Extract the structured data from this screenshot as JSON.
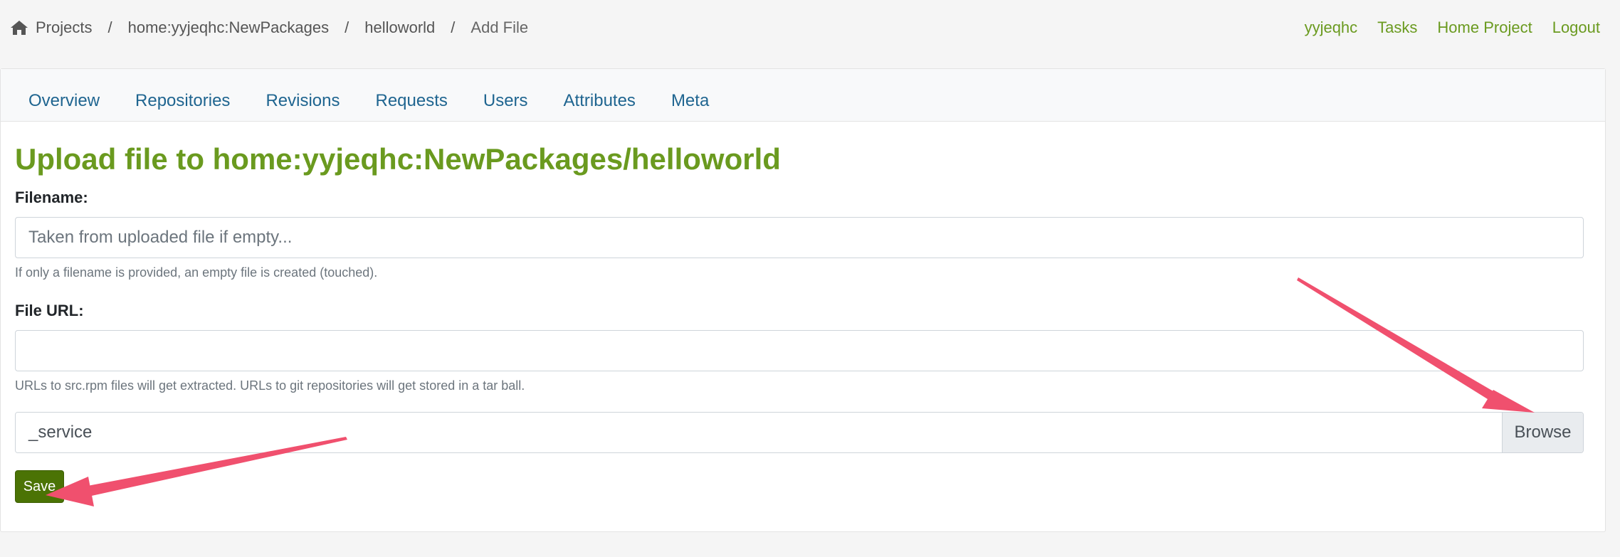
{
  "breadcrumb": {
    "items": [
      "Projects",
      "home:yyjeqhc:NewPackages",
      "helloworld"
    ],
    "current": "Add File",
    "separator": "/"
  },
  "user_nav": {
    "username": "yyjeqhc",
    "tasks": "Tasks",
    "home_project": "Home Project",
    "logout": "Logout"
  },
  "tabs": [
    "Overview",
    "Repositories",
    "Revisions",
    "Requests",
    "Users",
    "Attributes",
    "Meta"
  ],
  "form": {
    "title": "Upload file to home:yyjeqhc:NewPackages/helloworld",
    "filename_label": "Filename:",
    "filename_placeholder": "Taken from uploaded file if empty...",
    "filename_value": "",
    "filename_help": "If only a filename is provided, an empty file is created (touched).",
    "url_label": "File URL:",
    "url_value": "",
    "url_help": "URLs to src.rpm files will get extracted. URLs to git repositories will get stored in a tar ball.",
    "file_selected": "_service",
    "browse_label": "Browse",
    "save_label": "Save"
  },
  "colors": {
    "accent_green": "#6a9a1f",
    "tab_blue": "#1f6590",
    "save_button": "#4b7305",
    "annotation_arrow": "#f0506e"
  },
  "icons": {
    "home": "home-icon"
  }
}
